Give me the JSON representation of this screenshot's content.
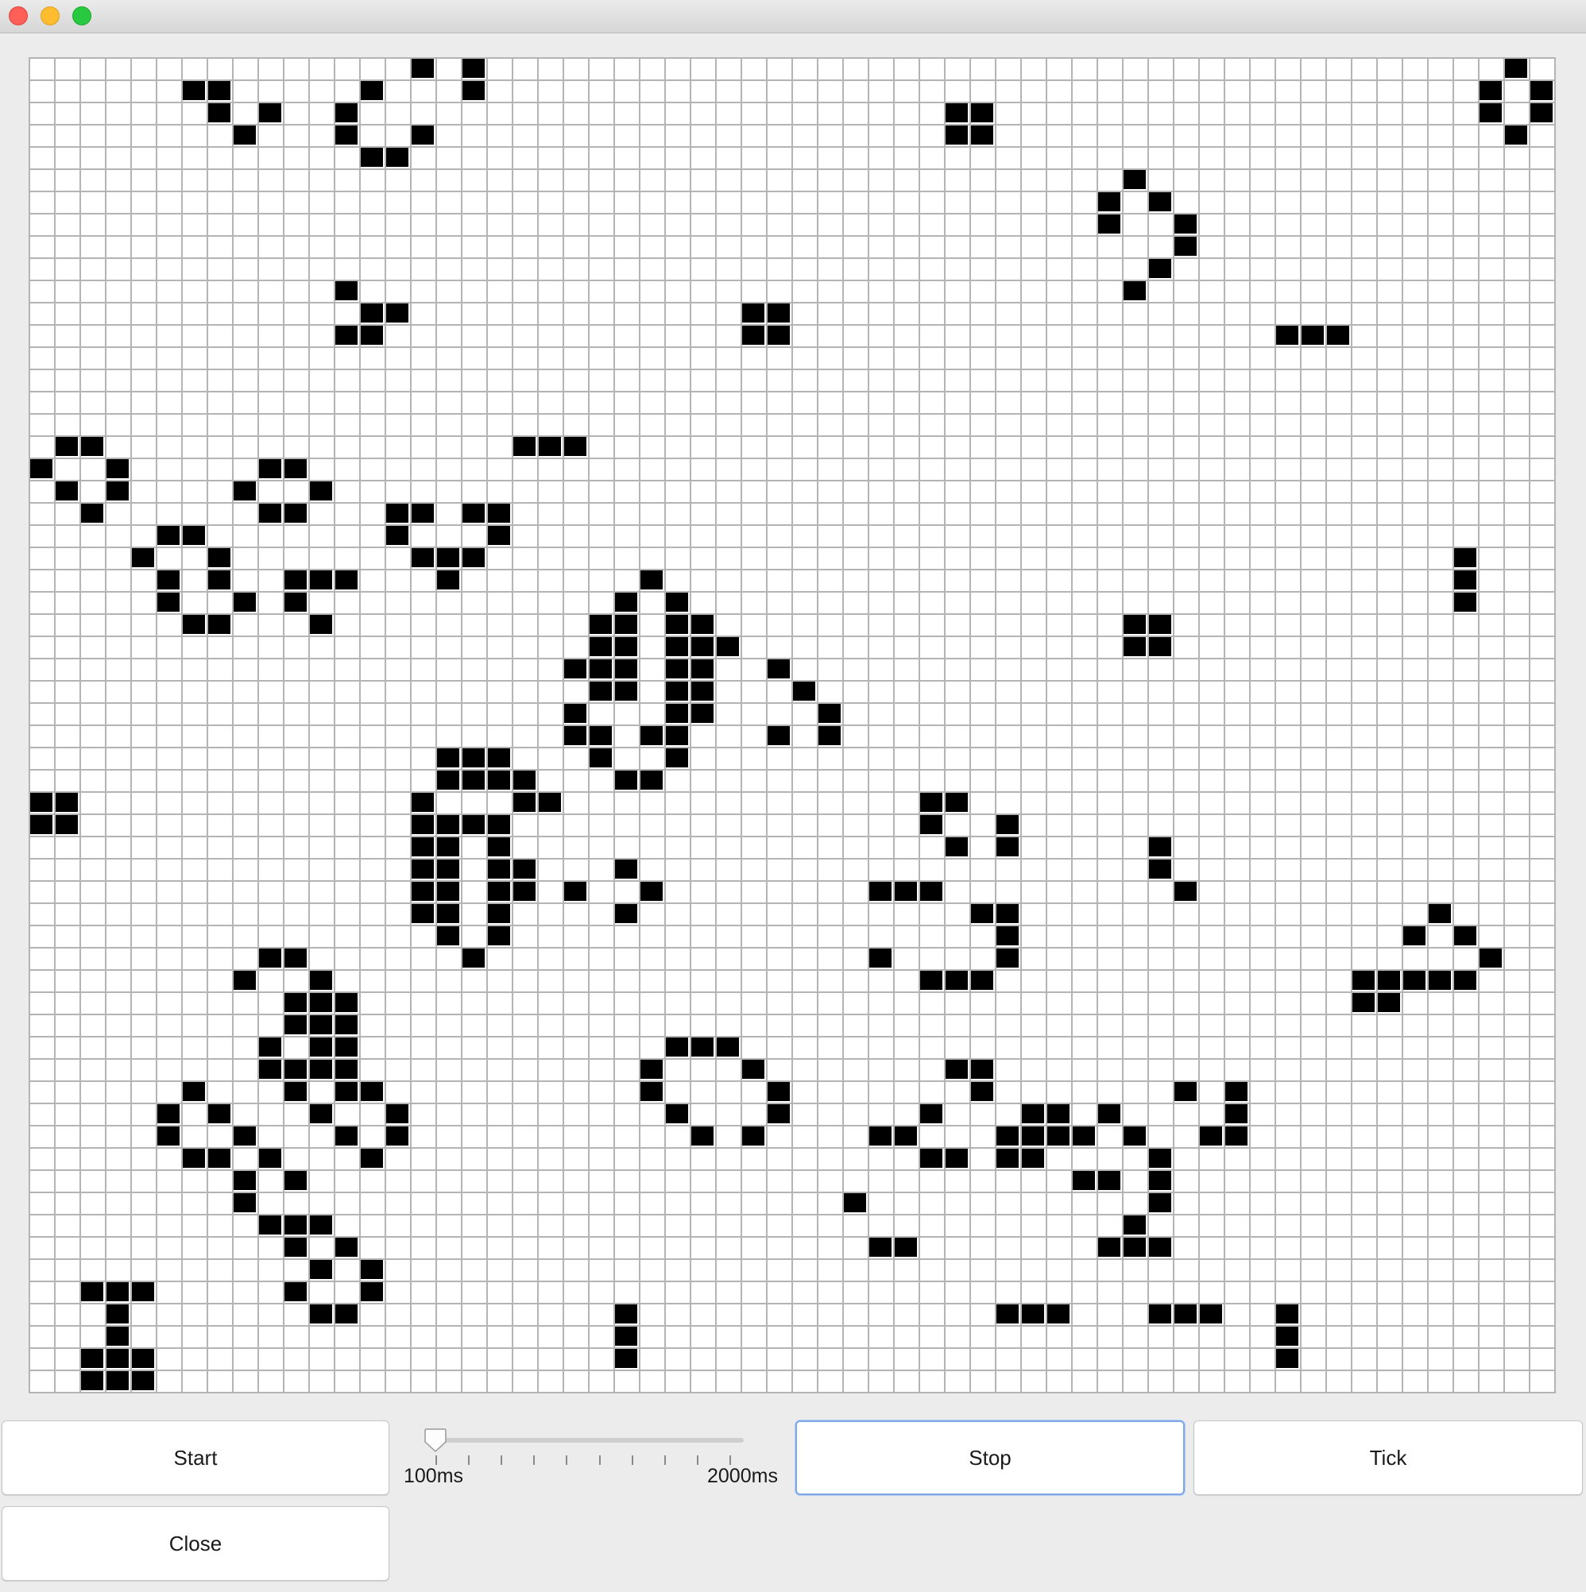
{
  "window": {
    "traffic_lights": [
      "close",
      "minimize",
      "maximize"
    ]
  },
  "grid": {
    "columns": 60,
    "rows": 60,
    "live_cell_color": "#000000",
    "dead_cell_color": "#ffffff",
    "grid_line_color": "#b4b4b4",
    "live_cells": [
      [
        0,
        15
      ],
      [
        0,
        17
      ],
      [
        1,
        6
      ],
      [
        1,
        7
      ],
      [
        1,
        13
      ],
      [
        1,
        17
      ],
      [
        2,
        7
      ],
      [
        2,
        9
      ],
      [
        2,
        12
      ],
      [
        3,
        8
      ],
      [
        3,
        12
      ],
      [
        3,
        15
      ],
      [
        4,
        13
      ],
      [
        4,
        14
      ],
      [
        2,
        36
      ],
      [
        2,
        37
      ],
      [
        3,
        36
      ],
      [
        3,
        37
      ],
      [
        0,
        58
      ],
      [
        1,
        57
      ],
      [
        1,
        59
      ],
      [
        2,
        57
      ],
      [
        2,
        59
      ],
      [
        3,
        58
      ],
      [
        5,
        43
      ],
      [
        6,
        42
      ],
      [
        6,
        44
      ],
      [
        7,
        42
      ],
      [
        7,
        45
      ],
      [
        8,
        45
      ],
      [
        9,
        44
      ],
      [
        10,
        43
      ],
      [
        10,
        12
      ],
      [
        11,
        13
      ],
      [
        11,
        14
      ],
      [
        12,
        12
      ],
      [
        12,
        13
      ],
      [
        11,
        28
      ],
      [
        11,
        29
      ],
      [
        12,
        28
      ],
      [
        12,
        29
      ],
      [
        12,
        49
      ],
      [
        12,
        50
      ],
      [
        12,
        51
      ],
      [
        17,
        19
      ],
      [
        17,
        20
      ],
      [
        17,
        21
      ],
      [
        17,
        1
      ],
      [
        17,
        2
      ],
      [
        18,
        0
      ],
      [
        18,
        3
      ],
      [
        19,
        1
      ],
      [
        19,
        3
      ],
      [
        20,
        2
      ],
      [
        18,
        9
      ],
      [
        18,
        10
      ],
      [
        19,
        8
      ],
      [
        19,
        11
      ],
      [
        20,
        9
      ],
      [
        20,
        10
      ],
      [
        20,
        14
      ],
      [
        20,
        15
      ],
      [
        20,
        17
      ],
      [
        20,
        18
      ],
      [
        21,
        14
      ],
      [
        21,
        18
      ],
      [
        22,
        15
      ],
      [
        22,
        16
      ],
      [
        22,
        17
      ],
      [
        23,
        16
      ],
      [
        21,
        5
      ],
      [
        21,
        6
      ],
      [
        22,
        4
      ],
      [
        22,
        7
      ],
      [
        23,
        5
      ],
      [
        23,
        7
      ],
      [
        24,
        5
      ],
      [
        24,
        8
      ],
      [
        25,
        6
      ],
      [
        25,
        7
      ],
      [
        23,
        10
      ],
      [
        23,
        11
      ],
      [
        23,
        12
      ],
      [
        24,
        10
      ],
      [
        25,
        11
      ],
      [
        22,
        56
      ],
      [
        23,
        56
      ],
      [
        24,
        56
      ],
      [
        23,
        24
      ],
      [
        24,
        23
      ],
      [
        24,
        25
      ],
      [
        25,
        22
      ],
      [
        25,
        23
      ],
      [
        25,
        25
      ],
      [
        25,
        26
      ],
      [
        26,
        22
      ],
      [
        26,
        23
      ],
      [
        26,
        25
      ],
      [
        26,
        26
      ],
      [
        26,
        27
      ],
      [
        27,
        21
      ],
      [
        27,
        22
      ],
      [
        27,
        23
      ],
      [
        27,
        25
      ],
      [
        27,
        26
      ],
      [
        28,
        22
      ],
      [
        28,
        23
      ],
      [
        28,
        25
      ],
      [
        28,
        26
      ],
      [
        29,
        21
      ],
      [
        29,
        25
      ],
      [
        29,
        26
      ],
      [
        30,
        21
      ],
      [
        30,
        22
      ],
      [
        30,
        24
      ],
      [
        30,
        25
      ],
      [
        31,
        22
      ],
      [
        31,
        25
      ],
      [
        32,
        23
      ],
      [
        32,
        24
      ],
      [
        25,
        43
      ],
      [
        25,
        44
      ],
      [
        26,
        43
      ],
      [
        26,
        44
      ],
      [
        27,
        29
      ],
      [
        28,
        30
      ],
      [
        29,
        31
      ],
      [
        30,
        29
      ],
      [
        30,
        31
      ],
      [
        31,
        16
      ],
      [
        31,
        17
      ],
      [
        31,
        18
      ],
      [
        32,
        16
      ],
      [
        32,
        17
      ],
      [
        32,
        18
      ],
      [
        32,
        19
      ],
      [
        33,
        15
      ],
      [
        33,
        19
      ],
      [
        33,
        20
      ],
      [
        34,
        15
      ],
      [
        34,
        16
      ],
      [
        34,
        17
      ],
      [
        34,
        18
      ],
      [
        35,
        15
      ],
      [
        35,
        16
      ],
      [
        35,
        18
      ],
      [
        36,
        15
      ],
      [
        36,
        16
      ],
      [
        36,
        18
      ],
      [
        36,
        19
      ],
      [
        37,
        15
      ],
      [
        37,
        16
      ],
      [
        37,
        18
      ],
      [
        37,
        19
      ],
      [
        38,
        15
      ],
      [
        38,
        16
      ],
      [
        38,
        18
      ],
      [
        39,
        16
      ],
      [
        39,
        18
      ],
      [
        40,
        17
      ],
      [
        33,
        0
      ],
      [
        33,
        1
      ],
      [
        34,
        0
      ],
      [
        34,
        1
      ],
      [
        36,
        23
      ],
      [
        37,
        21
      ],
      [
        37,
        24
      ],
      [
        38,
        23
      ],
      [
        33,
        35
      ],
      [
        33,
        36
      ],
      [
        34,
        35
      ],
      [
        34,
        38
      ],
      [
        35,
        36
      ],
      [
        35,
        38
      ],
      [
        35,
        44
      ],
      [
        36,
        44
      ],
      [
        37,
        45
      ],
      [
        37,
        33
      ],
      [
        37,
        34
      ],
      [
        37,
        35
      ],
      [
        38,
        37
      ],
      [
        38,
        38
      ],
      [
        39,
        38
      ],
      [
        40,
        33
      ],
      [
        40,
        38
      ],
      [
        41,
        35
      ],
      [
        41,
        36
      ],
      [
        41,
        37
      ],
      [
        38,
        55
      ],
      [
        39,
        54
      ],
      [
        39,
        56
      ],
      [
        40,
        57
      ],
      [
        41,
        52
      ],
      [
        41,
        53
      ],
      [
        41,
        54
      ],
      [
        41,
        55
      ],
      [
        41,
        56
      ],
      [
        42,
        52
      ],
      [
        42,
        53
      ],
      [
        40,
        9
      ],
      [
        40,
        10
      ],
      [
        41,
        8
      ],
      [
        41,
        11
      ],
      [
        42,
        10
      ],
      [
        42,
        11
      ],
      [
        42,
        12
      ],
      [
        43,
        10
      ],
      [
        43,
        11
      ],
      [
        43,
        12
      ],
      [
        44,
        9
      ],
      [
        44,
        11
      ],
      [
        44,
        12
      ],
      [
        45,
        9
      ],
      [
        45,
        10
      ],
      [
        45,
        11
      ],
      [
        45,
        12
      ],
      [
        46,
        6
      ],
      [
        46,
        10
      ],
      [
        46,
        12
      ],
      [
        46,
        13
      ],
      [
        47,
        5
      ],
      [
        47,
        7
      ],
      [
        47,
        11
      ],
      [
        47,
        14
      ],
      [
        48,
        5
      ],
      [
        48,
        8
      ],
      [
        48,
        12
      ],
      [
        48,
        14
      ],
      [
        49,
        6
      ],
      [
        49,
        7
      ],
      [
        49,
        9
      ],
      [
        49,
        13
      ],
      [
        50,
        8
      ],
      [
        50,
        10
      ],
      [
        51,
        8
      ],
      [
        52,
        9
      ],
      [
        52,
        10
      ],
      [
        52,
        11
      ],
      [
        53,
        10
      ],
      [
        53,
        12
      ],
      [
        54,
        11
      ],
      [
        54,
        13
      ],
      [
        55,
        10
      ],
      [
        55,
        13
      ],
      [
        56,
        11
      ],
      [
        56,
        12
      ],
      [
        44,
        25
      ],
      [
        44,
        26
      ],
      [
        44,
        27
      ],
      [
        45,
        24
      ],
      [
        45,
        28
      ],
      [
        46,
        24
      ],
      [
        46,
        29
      ],
      [
        47,
        25
      ],
      [
        47,
        29
      ],
      [
        48,
        26
      ],
      [
        48,
        28
      ],
      [
        45,
        36
      ],
      [
        45,
        37
      ],
      [
        46,
        37
      ],
      [
        47,
        35
      ],
      [
        48,
        33
      ],
      [
        48,
        34
      ],
      [
        49,
        35
      ],
      [
        49,
        36
      ],
      [
        47,
        39
      ],
      [
        47,
        40
      ],
      [
        47,
        42
      ],
      [
        48,
        38
      ],
      [
        48,
        39
      ],
      [
        48,
        40
      ],
      [
        48,
        41
      ],
      [
        49,
        38
      ],
      [
        49,
        39
      ],
      [
        48,
        43
      ],
      [
        49,
        44
      ],
      [
        50,
        41
      ],
      [
        50,
        42
      ],
      [
        50,
        44
      ],
      [
        51,
        44
      ],
      [
        52,
        43
      ],
      [
        53,
        42
      ],
      [
        53,
        43
      ],
      [
        53,
        44
      ],
      [
        46,
        45
      ],
      [
        46,
        47
      ],
      [
        47,
        47
      ],
      [
        48,
        46
      ],
      [
        48,
        47
      ],
      [
        51,
        32
      ],
      [
        53,
        33
      ],
      [
        53,
        34
      ],
      [
        55,
        2
      ],
      [
        55,
        3
      ],
      [
        55,
        4
      ],
      [
        56,
        3
      ],
      [
        57,
        3
      ],
      [
        58,
        2
      ],
      [
        58,
        3
      ],
      [
        58,
        4
      ],
      [
        59,
        2
      ],
      [
        59,
        3
      ],
      [
        59,
        4
      ],
      [
        56,
        23
      ],
      [
        57,
        23
      ],
      [
        58,
        23
      ],
      [
        56,
        38
      ],
      [
        56,
        39
      ],
      [
        56,
        40
      ],
      [
        56,
        44
      ],
      [
        56,
        45
      ],
      [
        56,
        46
      ],
      [
        56,
        49
      ],
      [
        57,
        49
      ],
      [
        58,
        49
      ]
    ]
  },
  "controls": {
    "start_label": "Start",
    "stop_label": "Stop",
    "tick_label": "Tick",
    "close_label": "Close",
    "speed": {
      "min_label": "100ms",
      "max_label": "2000ms",
      "value_fraction": 0,
      "tick_count": 10
    }
  }
}
